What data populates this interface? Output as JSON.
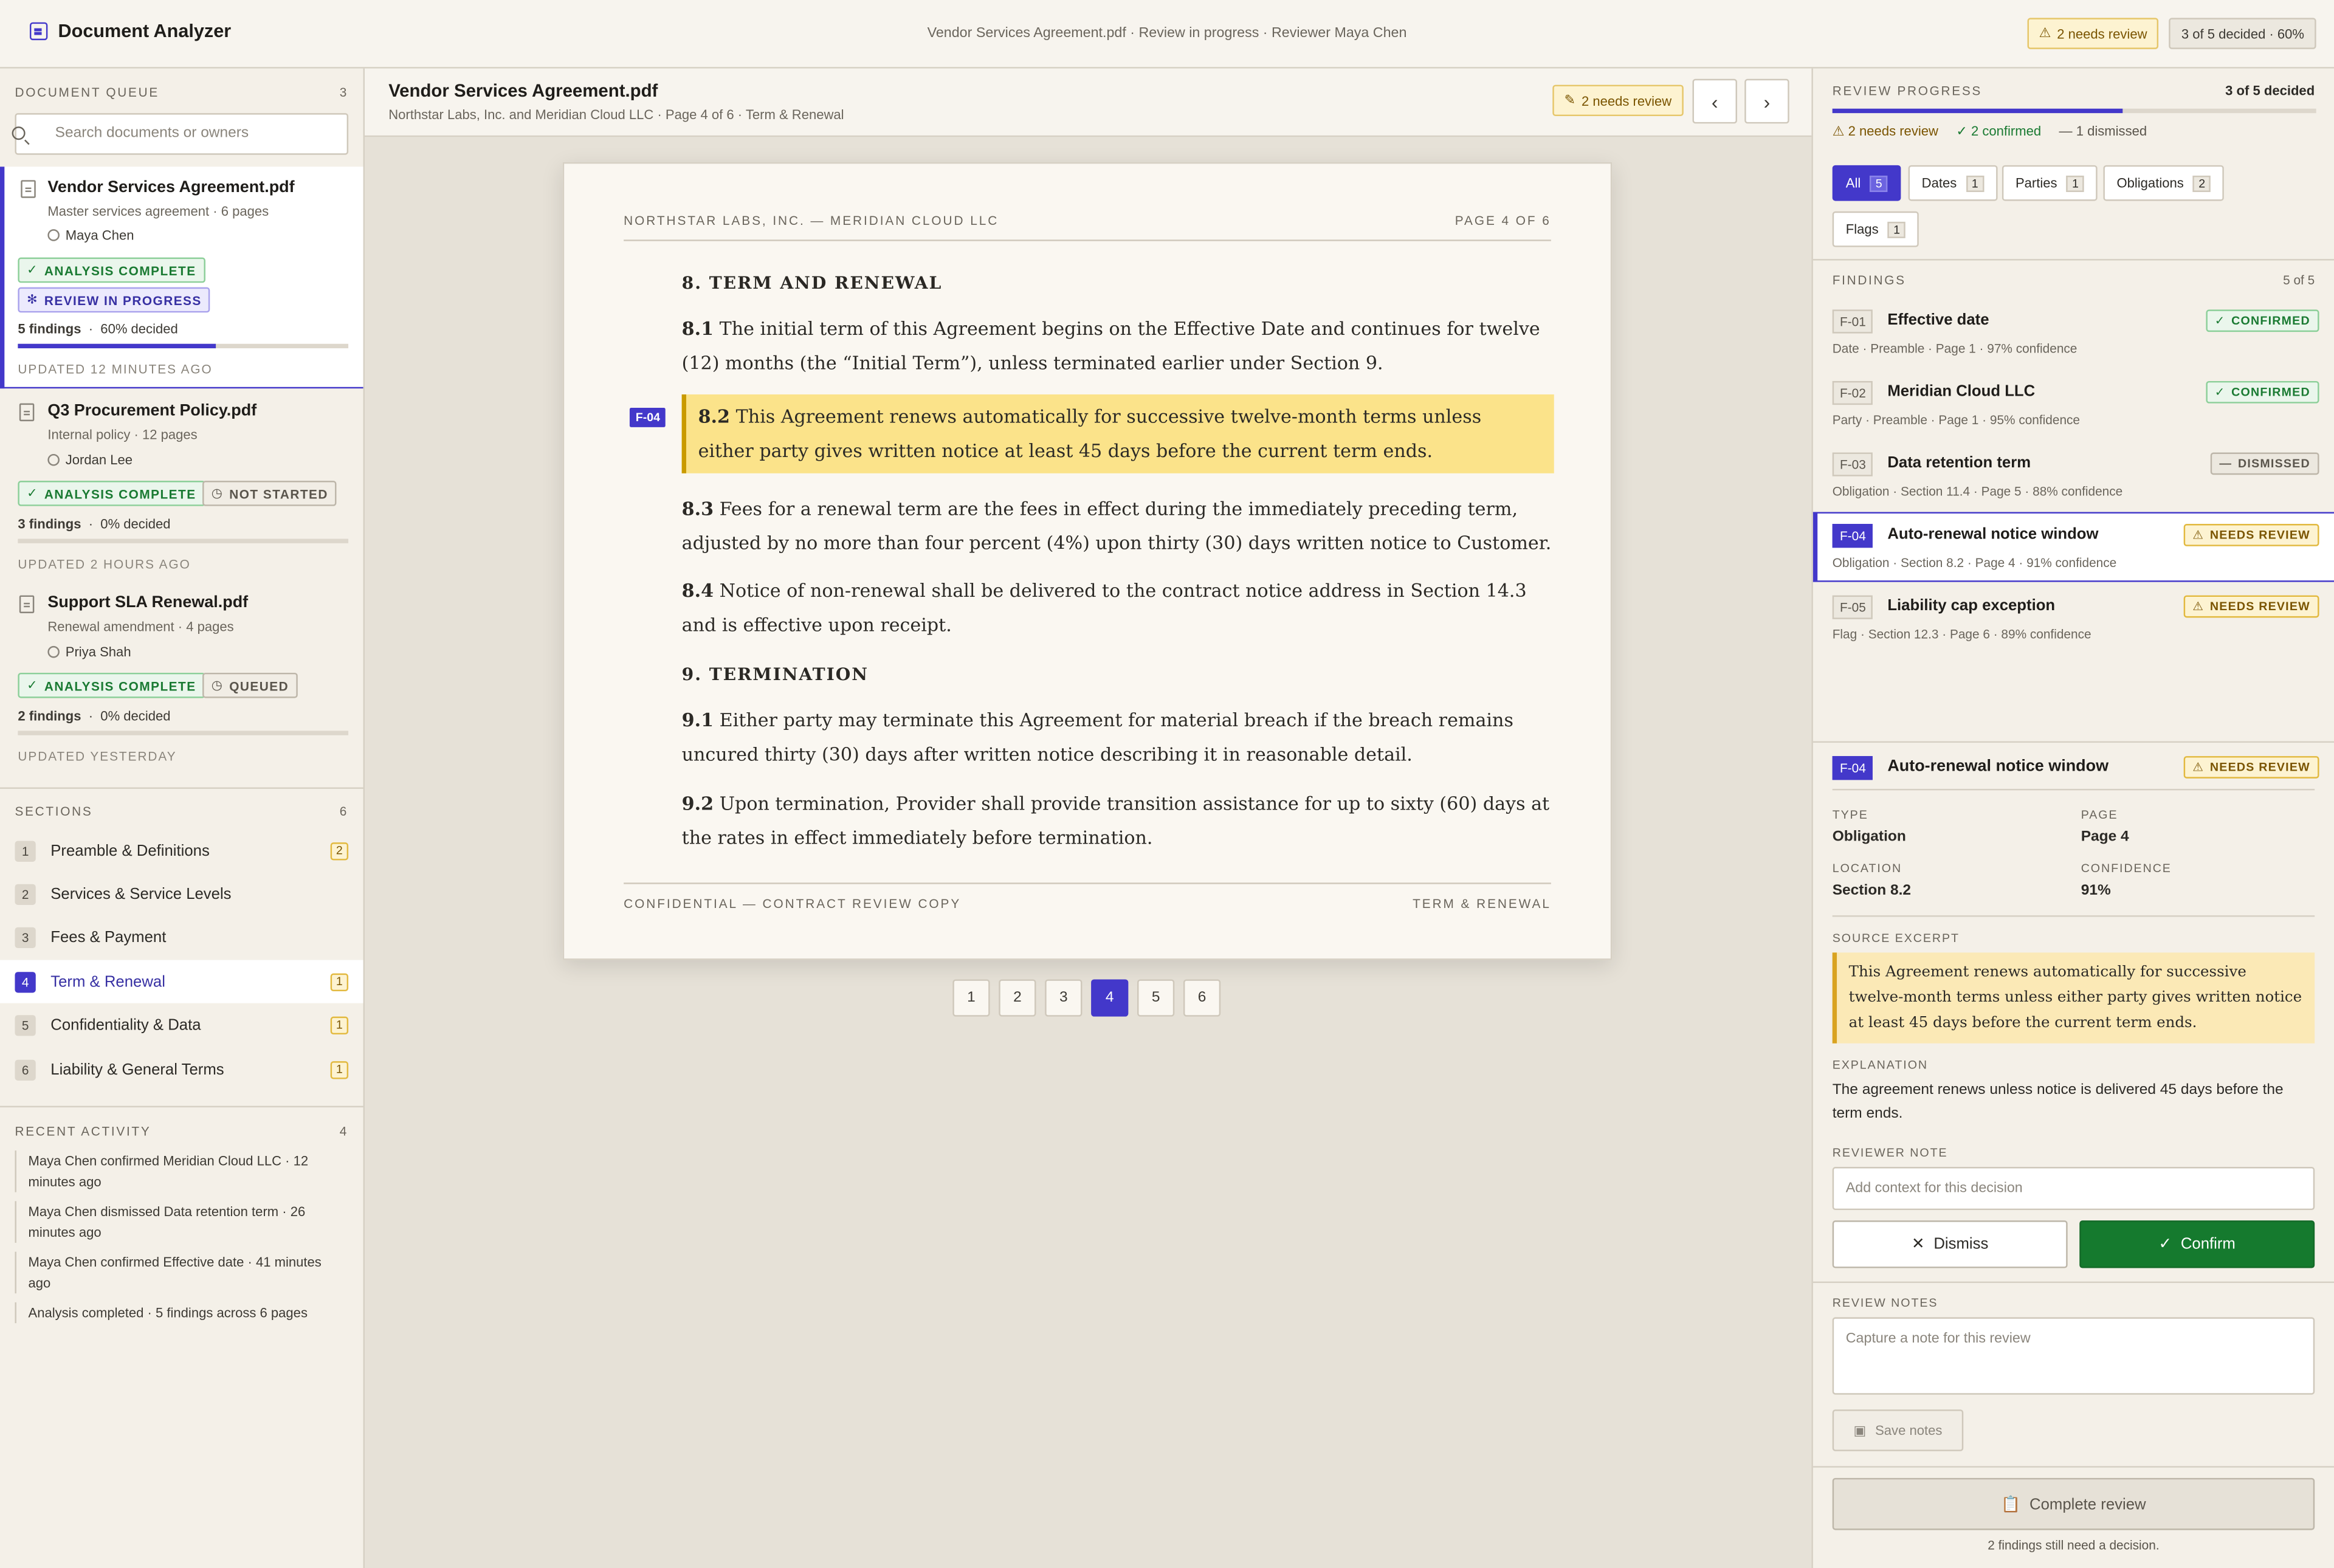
{
  "app": {
    "title": "Document Analyzer",
    "context": "Vendor Services Agreement.pdf · Review in progress · Reviewer Maya Chen",
    "needs_review": "2 needs review",
    "decided": "3 of 5 decided · 60%"
  },
  "queue": {
    "heading": "DOCUMENT QUEUE",
    "count": "3",
    "search_placeholder": "Search documents or owners",
    "docs": [
      {
        "title": "Vendor Services Agreement.pdf",
        "sub": "Master services agreement · 6 pages",
        "owner": "Maya Chen",
        "badge1": "ANALYSIS COMPLETE",
        "badge2": "REVIEW IN PROGRESS",
        "findings": "5 findings",
        "decided": "60% decided",
        "progress": 0.6,
        "updated": "UPDATED 12 MINUTES AGO"
      },
      {
        "title": "Q3 Procurement Policy.pdf",
        "sub": "Internal policy · 12 pages",
        "owner": "Jordan Lee",
        "badge1": "ANALYSIS COMPLETE",
        "badge2": "NOT STARTED",
        "findings": "3 findings",
        "decided": "0% decided",
        "progress": 0,
        "updated": "UPDATED 2 HOURS AGO"
      },
      {
        "title": "Support SLA Renewal.pdf",
        "sub": "Renewal amendment · 4 pages",
        "owner": "Priya Shah",
        "badge1": "ANALYSIS COMPLETE",
        "badge2": "QUEUED",
        "findings": "2 findings",
        "decided": "0% decided",
        "progress": 0,
        "updated": "UPDATED YESTERDAY"
      }
    ]
  },
  "sections": {
    "heading": "SECTIONS",
    "count": "6",
    "items": [
      {
        "num": "1",
        "label": "Preamble & Definitions",
        "count": "2"
      },
      {
        "num": "2",
        "label": "Services & Service Levels",
        "count": ""
      },
      {
        "num": "3",
        "label": "Fees & Payment",
        "count": ""
      },
      {
        "num": "4",
        "label": "Term & Renewal",
        "count": "1"
      },
      {
        "num": "5",
        "label": "Confidentiality & Data",
        "count": "1"
      },
      {
        "num": "6",
        "label": "Liability & General Terms",
        "count": "1"
      }
    ]
  },
  "activity": {
    "heading": "RECENT ACTIVITY",
    "count": "4",
    "items": [
      "Maya Chen confirmed Meridian Cloud LLC · 12 minutes ago",
      "Maya Chen dismissed Data retention term · 26 minutes ago",
      "Maya Chen confirmed Effective date · 41 minutes ago",
      "Analysis completed · 5 findings across 6 pages"
    ]
  },
  "viewer": {
    "title": "Vendor Services Agreement.pdf",
    "sub": "Northstar Labs, Inc. and Meridian Cloud LLC · Page 4 of 6 · Term & Renewal",
    "needs_review": "2 needs review",
    "page_head_left": "NORTHSTAR LABS, INC. — MERIDIAN CLOUD LLC",
    "page_head_right": "PAGE 4 OF 6",
    "h8": "8. TERM AND RENEWAL",
    "p81n": "8.1",
    "p81": "The initial term of this Agreement begins on the Effective Date and continues for twelve (12) months (the “Initial Term”), unless terminated earlier under Section 9.",
    "tag": "F-04",
    "p82n": "8.2",
    "p82": "This Agreement renews automatically for successive twelve-month terms unless either party gives written notice at least 45 days before the current term ends.",
    "p83n": "8.3",
    "p83": "Fees for a renewal term are the fees in effect during the immediately preceding term, adjusted by no more than four percent (4%) upon thirty (30) days written notice to Customer.",
    "p84n": "8.4",
    "p84": "Notice of non-renewal shall be delivered to the contract notice address in Section 14.3 and is effective upon receipt.",
    "h9": "9. TERMINATION",
    "p91n": "9.1",
    "p91": "Either party may terminate this Agreement for material breach if the breach remains uncured thirty (30) days after written notice describing it in reasonable detail.",
    "p92n": "9.2",
    "p92": "Upon termination, Provider shall provide transition assistance for up to sixty (60) days at the rates in effect immediately before termination.",
    "foot_left": "CONFIDENTIAL — CONTRACT REVIEW COPY",
    "foot_right": "TERM & RENEWAL",
    "pages": [
      "1",
      "2",
      "3",
      "4",
      "5",
      "6"
    ]
  },
  "review": {
    "heading": "REVIEW PROGRESS",
    "decided": "3 of 5 decided",
    "progress": 0.6,
    "needs": "2 needs review",
    "confirmed": "2 confirmed",
    "dismissed": "1 dismissed",
    "filters": [
      {
        "label": "All",
        "n": "5"
      },
      {
        "label": "Dates",
        "n": "1"
      },
      {
        "label": "Parties",
        "n": "1"
      },
      {
        "label": "Obligations",
        "n": "2"
      },
      {
        "label": "Flags",
        "n": "1"
      }
    ],
    "findings_heading": "FINDINGS",
    "findings_count": "5 of 5",
    "findings": [
      {
        "id": "F-01",
        "name": "Effective date",
        "meta": "Date · Preamble · Page 1 · 97% confidence",
        "status": "CONFIRMED"
      },
      {
        "id": "F-02",
        "name": "Meridian Cloud LLC",
        "meta": "Party · Preamble · Page 1 · 95% confidence",
        "status": "CONFIRMED"
      },
      {
        "id": "F-03",
        "name": "Data retention term",
        "meta": "Obligation · Section 11.4 · Page 5 · 88% confidence",
        "status": "DISMISSED"
      },
      {
        "id": "F-04",
        "name": "Auto-renewal notice window",
        "meta": "Obligation · Section 8.2 · Page 4 · 91% confidence",
        "status": "NEEDS REVIEW"
      },
      {
        "id": "F-05",
        "name": "Liability cap exception",
        "meta": "Flag · Section 12.3 · Page 6 · 89% confidence",
        "status": "NEEDS REVIEW"
      }
    ],
    "detail": {
      "id": "F-04",
      "name": "Auto-renewal notice window",
      "status": "NEEDS REVIEW",
      "type_l": "TYPE",
      "type": "Obligation",
      "page_l": "PAGE",
      "page": "Page 4",
      "loc_l": "LOCATION",
      "loc": "Section 8.2",
      "conf_l": "CONFIDENCE",
      "conf": "91%",
      "excerpt_l": "SOURCE EXCERPT",
      "excerpt": "This Agreement renews automatically for successive twelve-month terms unless either party gives written notice at least 45 days before the current term ends.",
      "expl_l": "EXPLANATION",
      "expl": "The agreement renews unless notice is delivered 45 days before the term ends.",
      "note_l": "REVIEWER NOTE",
      "note_ph": "Add context for this decision",
      "dismiss": "Dismiss",
      "confirm": "Confirm"
    },
    "notes_l": "REVIEW NOTES",
    "notes_ph": "Capture a note for this review",
    "save": "Save notes",
    "complete": "Complete review",
    "remaining": "2 findings still need a decision."
  }
}
